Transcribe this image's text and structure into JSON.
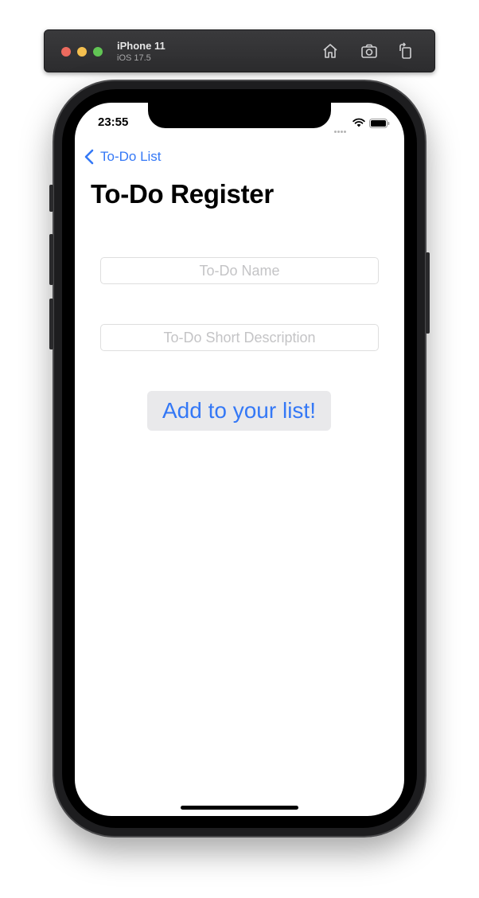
{
  "simulator": {
    "device_name": "iPhone 11",
    "os_version": "iOS 17.5",
    "toolbar_icons": [
      "home-icon",
      "screenshot-icon",
      "rotate-icon"
    ]
  },
  "status_bar": {
    "time": "23:55"
  },
  "nav": {
    "back_label": "To-Do List"
  },
  "page": {
    "title": "To-Do Register"
  },
  "form": {
    "name_field": {
      "value": "",
      "placeholder": "To-Do Name"
    },
    "description_field": {
      "value": "",
      "placeholder": "To-Do Short Description"
    },
    "submit_label": "Add to your list!"
  },
  "colors": {
    "accent": "#3478f6",
    "button_bg": "#e9e9eb",
    "placeholder": "#c4c4c6"
  }
}
